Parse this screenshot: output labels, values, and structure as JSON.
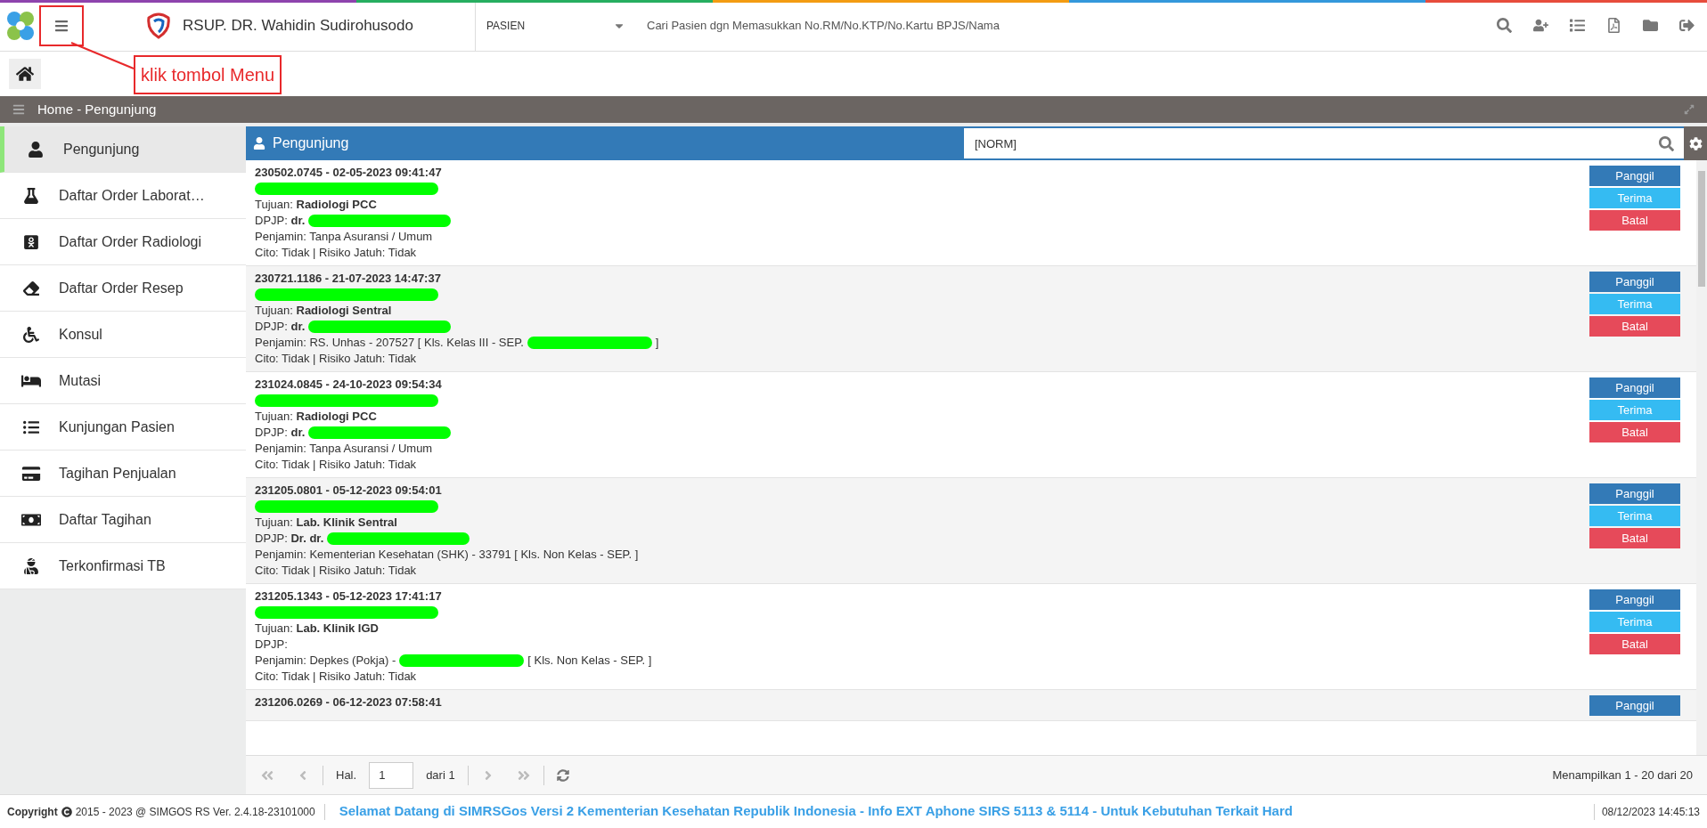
{
  "topbar": {
    "hospital_name": "RSUP. DR. Wahidin Sudirohusodo",
    "search_type": "PASIEN",
    "search_placeholder": "Cari Pasien dgn Memasukkan No.RM/No.KTP/No.Kartu BPJS/Nama"
  },
  "annotation": {
    "text": "klik tombol Menu"
  },
  "breadcrumb": "Home - Pengunjung",
  "sidebar": {
    "items": [
      {
        "label": "Pengunjung",
        "selected": true
      },
      {
        "label": "Daftar Order Laborat…",
        "selected": false
      },
      {
        "label": "Daftar Order Radiologi",
        "selected": false
      },
      {
        "label": "Daftar Order Resep",
        "selected": false
      },
      {
        "label": "Konsul",
        "selected": false
      },
      {
        "label": "Mutasi",
        "selected": false
      },
      {
        "label": "Kunjungan Pasien",
        "selected": false
      },
      {
        "label": "Tagihan Penjualan",
        "selected": false
      },
      {
        "label": "Daftar Tagihan",
        "selected": false
      },
      {
        "label": "Terkonfirmasi TB",
        "selected": false
      }
    ]
  },
  "panel": {
    "title": "Pengunjung",
    "search_value": "[NORM]",
    "rows": [
      {
        "header": "230502.0745 - 02-05-2023 09:41:47",
        "name_redacted": true,
        "lines": [
          {
            "text": "Tujuan: **Radiologi PCC**",
            "redacted": false
          },
          {
            "text": "DPJP: **dr.**",
            "redacted": true
          },
          {
            "text": "Penjamin: Tanpa Asuransi / Umum",
            "redacted": false
          },
          {
            "text": "Cito: Tidak | Risiko Jatuh: Tidak",
            "redacted": false
          }
        ],
        "actions": [
          {
            "label": "Panggil",
            "kind": "call"
          },
          {
            "label": "Terima",
            "kind": "accept"
          },
          {
            "label": "Batal",
            "kind": "cancel"
          }
        ]
      },
      {
        "header": "230721.1186 - 21-07-2023 14:47:37",
        "name_redacted": true,
        "lines": [
          {
            "text": "Tujuan: **Radiologi Sentral**",
            "redacted": false
          },
          {
            "text": "DPJP: **dr.**",
            "redacted": true
          },
          {
            "text": "Penjamin: RS. Unhas - 207527 [ Kls. Kelas III - SEP.",
            "redacted": true,
            "after": "]"
          },
          {
            "text": "Cito: Tidak | Risiko Jatuh: Tidak",
            "redacted": false
          }
        ],
        "actions": [
          {
            "label": "Panggil",
            "kind": "call"
          },
          {
            "label": "Terima",
            "kind": "accept"
          },
          {
            "label": "Batal",
            "kind": "cancel"
          }
        ]
      },
      {
        "header": "231024.0845 - 24-10-2023 09:54:34",
        "name_redacted": true,
        "lines": [
          {
            "text": "Tujuan: **Radiologi PCC**",
            "redacted": false
          },
          {
            "text": "DPJP: **dr.**",
            "redacted": true
          },
          {
            "text": "Penjamin: Tanpa Asuransi / Umum",
            "redacted": false
          },
          {
            "text": "Cito: Tidak | Risiko Jatuh: Tidak",
            "redacted": false
          }
        ],
        "actions": [
          {
            "label": "Panggil",
            "kind": "call"
          },
          {
            "label": "Terima",
            "kind": "accept"
          },
          {
            "label": "Batal",
            "kind": "cancel"
          }
        ]
      },
      {
        "header": "231205.0801 - 05-12-2023 09:54:01",
        "name_redacted": true,
        "lines": [
          {
            "text": "Tujuan: **Lab. Klinik Sentral**",
            "redacted": false
          },
          {
            "text": "DPJP: **Dr. dr.**",
            "redacted": true
          },
          {
            "text": "Penjamin: Kementerian Kesehatan (SHK) - 33791 [ Kls. Non Kelas - SEP. ]",
            "redacted": false
          },
          {
            "text": "Cito: Tidak | Risiko Jatuh: Tidak",
            "redacted": false
          }
        ],
        "actions": [
          {
            "label": "Panggil",
            "kind": "call"
          },
          {
            "label": "Terima",
            "kind": "accept"
          },
          {
            "label": "Batal",
            "kind": "cancel"
          }
        ]
      },
      {
        "header": "231205.1343 - 05-12-2023 17:41:17",
        "name_redacted": true,
        "lines": [
          {
            "text": "Tujuan: **Lab. Klinik IGD**",
            "redacted": false
          },
          {
            "text": "DPJP:",
            "redacted": false
          },
          {
            "text": "Penjamin: Depkes (Pokja) -",
            "redacted": true,
            "after": "[ Kls. Non Kelas - SEP. ]"
          },
          {
            "text": "Cito: Tidak | Risiko Jatuh: Tidak",
            "redacted": false
          }
        ],
        "actions": [
          {
            "label": "Panggil",
            "kind": "call"
          },
          {
            "label": "Terima",
            "kind": "accept"
          },
          {
            "label": "Batal",
            "kind": "cancel"
          }
        ]
      },
      {
        "header": "231206.0269 - 06-12-2023 07:58:41",
        "name_redacted": false,
        "lines": [],
        "actions": [
          {
            "label": "Panggil",
            "kind": "call"
          }
        ]
      }
    ]
  },
  "pagination": {
    "page_label": "Hal.",
    "page": "1",
    "of": "dari 1",
    "summary": "Menampilkan 1 - 20 dari 20"
  },
  "footer": {
    "copyright": "Copyright",
    "version": "2015 - 2023 @ SIMGOS RS Ver. 2.4.18-23101000",
    "marquee": "Selamat Datang di SIMRSGos Versi 2 Kementerian Kesehatan Republik Indonesia - Info EXT Aphone SIRS 5113 & 5114 - Untuk Kebutuhan Terkait Hard",
    "datetime": "08/12/2023 14:45:13"
  }
}
